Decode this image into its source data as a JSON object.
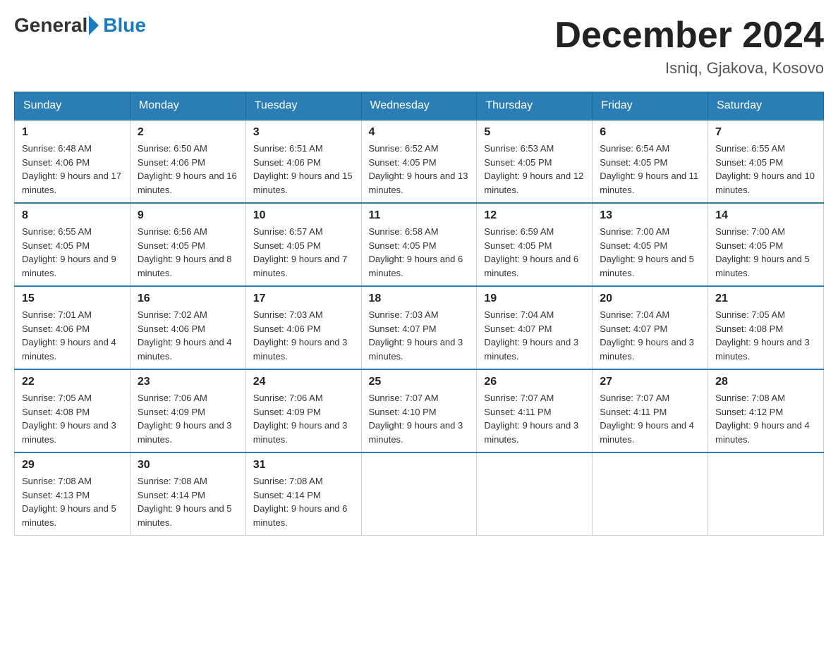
{
  "logo": {
    "general": "General",
    "blue": "Blue"
  },
  "title": "December 2024",
  "location": "Isniq, Gjakova, Kosovo",
  "days_of_week": [
    "Sunday",
    "Monday",
    "Tuesday",
    "Wednesday",
    "Thursday",
    "Friday",
    "Saturday"
  ],
  "weeks": [
    [
      {
        "date": "1",
        "sunrise": "6:48 AM",
        "sunset": "4:06 PM",
        "daylight": "9 hours and 17 minutes."
      },
      {
        "date": "2",
        "sunrise": "6:50 AM",
        "sunset": "4:06 PM",
        "daylight": "9 hours and 16 minutes."
      },
      {
        "date": "3",
        "sunrise": "6:51 AM",
        "sunset": "4:06 PM",
        "daylight": "9 hours and 15 minutes."
      },
      {
        "date": "4",
        "sunrise": "6:52 AM",
        "sunset": "4:05 PM",
        "daylight": "9 hours and 13 minutes."
      },
      {
        "date": "5",
        "sunrise": "6:53 AM",
        "sunset": "4:05 PM",
        "daylight": "9 hours and 12 minutes."
      },
      {
        "date": "6",
        "sunrise": "6:54 AM",
        "sunset": "4:05 PM",
        "daylight": "9 hours and 11 minutes."
      },
      {
        "date": "7",
        "sunrise": "6:55 AM",
        "sunset": "4:05 PM",
        "daylight": "9 hours and 10 minutes."
      }
    ],
    [
      {
        "date": "8",
        "sunrise": "6:55 AM",
        "sunset": "4:05 PM",
        "daylight": "9 hours and 9 minutes."
      },
      {
        "date": "9",
        "sunrise": "6:56 AM",
        "sunset": "4:05 PM",
        "daylight": "9 hours and 8 minutes."
      },
      {
        "date": "10",
        "sunrise": "6:57 AM",
        "sunset": "4:05 PM",
        "daylight": "9 hours and 7 minutes."
      },
      {
        "date": "11",
        "sunrise": "6:58 AM",
        "sunset": "4:05 PM",
        "daylight": "9 hours and 6 minutes."
      },
      {
        "date": "12",
        "sunrise": "6:59 AM",
        "sunset": "4:05 PM",
        "daylight": "9 hours and 6 minutes."
      },
      {
        "date": "13",
        "sunrise": "7:00 AM",
        "sunset": "4:05 PM",
        "daylight": "9 hours and 5 minutes."
      },
      {
        "date": "14",
        "sunrise": "7:00 AM",
        "sunset": "4:05 PM",
        "daylight": "9 hours and 5 minutes."
      }
    ],
    [
      {
        "date": "15",
        "sunrise": "7:01 AM",
        "sunset": "4:06 PM",
        "daylight": "9 hours and 4 minutes."
      },
      {
        "date": "16",
        "sunrise": "7:02 AM",
        "sunset": "4:06 PM",
        "daylight": "9 hours and 4 minutes."
      },
      {
        "date": "17",
        "sunrise": "7:03 AM",
        "sunset": "4:06 PM",
        "daylight": "9 hours and 3 minutes."
      },
      {
        "date": "18",
        "sunrise": "7:03 AM",
        "sunset": "4:07 PM",
        "daylight": "9 hours and 3 minutes."
      },
      {
        "date": "19",
        "sunrise": "7:04 AM",
        "sunset": "4:07 PM",
        "daylight": "9 hours and 3 minutes."
      },
      {
        "date": "20",
        "sunrise": "7:04 AM",
        "sunset": "4:07 PM",
        "daylight": "9 hours and 3 minutes."
      },
      {
        "date": "21",
        "sunrise": "7:05 AM",
        "sunset": "4:08 PM",
        "daylight": "9 hours and 3 minutes."
      }
    ],
    [
      {
        "date": "22",
        "sunrise": "7:05 AM",
        "sunset": "4:08 PM",
        "daylight": "9 hours and 3 minutes."
      },
      {
        "date": "23",
        "sunrise": "7:06 AM",
        "sunset": "4:09 PM",
        "daylight": "9 hours and 3 minutes."
      },
      {
        "date": "24",
        "sunrise": "7:06 AM",
        "sunset": "4:09 PM",
        "daylight": "9 hours and 3 minutes."
      },
      {
        "date": "25",
        "sunrise": "7:07 AM",
        "sunset": "4:10 PM",
        "daylight": "9 hours and 3 minutes."
      },
      {
        "date": "26",
        "sunrise": "7:07 AM",
        "sunset": "4:11 PM",
        "daylight": "9 hours and 3 minutes."
      },
      {
        "date": "27",
        "sunrise": "7:07 AM",
        "sunset": "4:11 PM",
        "daylight": "9 hours and 4 minutes."
      },
      {
        "date": "28",
        "sunrise": "7:08 AM",
        "sunset": "4:12 PM",
        "daylight": "9 hours and 4 minutes."
      }
    ],
    [
      {
        "date": "29",
        "sunrise": "7:08 AM",
        "sunset": "4:13 PM",
        "daylight": "9 hours and 5 minutes."
      },
      {
        "date": "30",
        "sunrise": "7:08 AM",
        "sunset": "4:14 PM",
        "daylight": "9 hours and 5 minutes."
      },
      {
        "date": "31",
        "sunrise": "7:08 AM",
        "sunset": "4:14 PM",
        "daylight": "9 hours and 6 minutes."
      },
      null,
      null,
      null,
      null
    ]
  ],
  "labels": {
    "sunrise_prefix": "Sunrise: ",
    "sunset_prefix": "Sunset: ",
    "daylight_prefix": "Daylight: "
  }
}
